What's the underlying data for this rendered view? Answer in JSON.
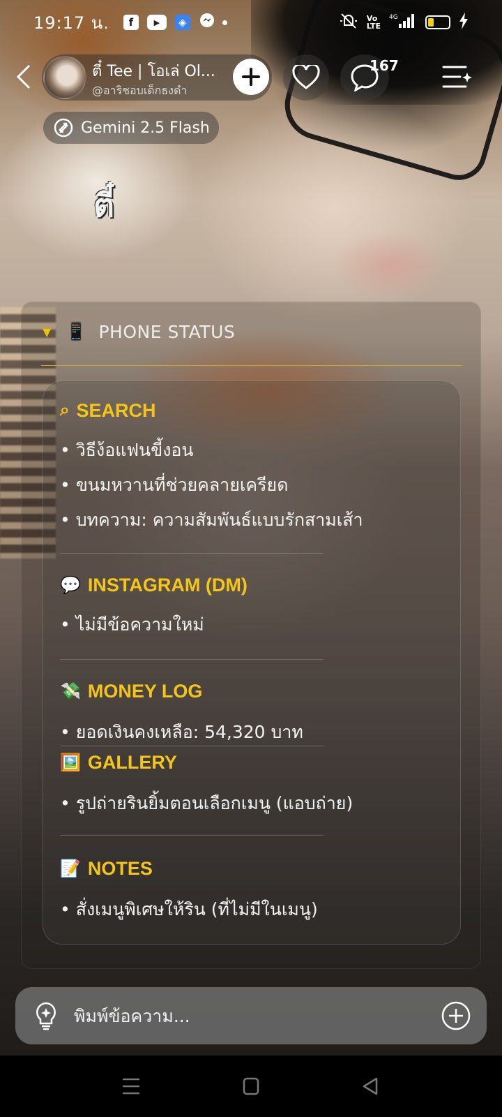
{
  "status_bar": {
    "time": "19:17 น.",
    "apps": [
      "facebook-icon",
      "youtube-icon",
      "browser-icon",
      "messenger-icon"
    ],
    "network": "4G",
    "battery_level": 0.3
  },
  "header": {
    "character_name": "ตี๋ Tee | โอเล่ Ol...",
    "character_handle": "@อาริชอบเด็กธงดำ",
    "comment_count": "167",
    "model_name": "Gemini 2.5 Flash"
  },
  "watermark": "ตี๋",
  "panel": {
    "title": "PHONE STATUS",
    "title_icon": "📱",
    "sections": [
      {
        "icon": "⌕",
        "title": "SEARCH",
        "items": [
          "• วิธีง้อแฟนขี้งอน",
          "• ขนมหวานที่ช่วยคลายเครียด",
          "• บทความ: ความสัมพันธ์แบบรักสามเส้า"
        ]
      },
      {
        "icon": "💬",
        "title": "INSTAGRAM (DM)",
        "items": [
          "• ไม่มีข้อความใหม่"
        ]
      },
      {
        "icon": "💸",
        "title": "MONEY LOG",
        "items": [
          "• ยอดเงินคงเหลือ: 54,320 บาท"
        ]
      },
      {
        "icon": "🖼️",
        "title": "GALLERY",
        "items": [
          "• รูปถ่ายรินยิ้มตอนเลือกเมนู (แอบถ่าย)"
        ]
      },
      {
        "icon": "📝",
        "title": "NOTES",
        "items": [
          "• สั่งเมนูพิเศษให้ริน (ที่ไม่มีในเมนู)"
        ]
      }
    ]
  },
  "composer": {
    "placeholder": "พิมพ์ข้อความ..."
  },
  "colors": {
    "accent": "#f5c518",
    "rule": "#c8a830"
  }
}
